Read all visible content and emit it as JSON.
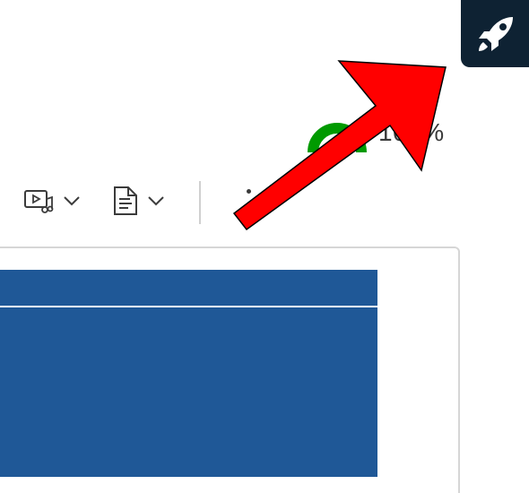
{
  "launcher": {
    "icon": "rocket-icon",
    "bg_color": "#0e2233"
  },
  "progress": {
    "text": "100%",
    "percent": 100,
    "color": "#009a00"
  },
  "toolbar": {
    "media_icon": "media-play-music-icon",
    "document_icon": "document-lines-icon",
    "chevron_icon": "chevron-down-icon",
    "more_icon": "more-dots-icon"
  },
  "slide": {
    "color": "#1f5897"
  },
  "annotation": {
    "arrow_color": "#ff0000",
    "arrow_icon": "red-arrow-icon"
  }
}
